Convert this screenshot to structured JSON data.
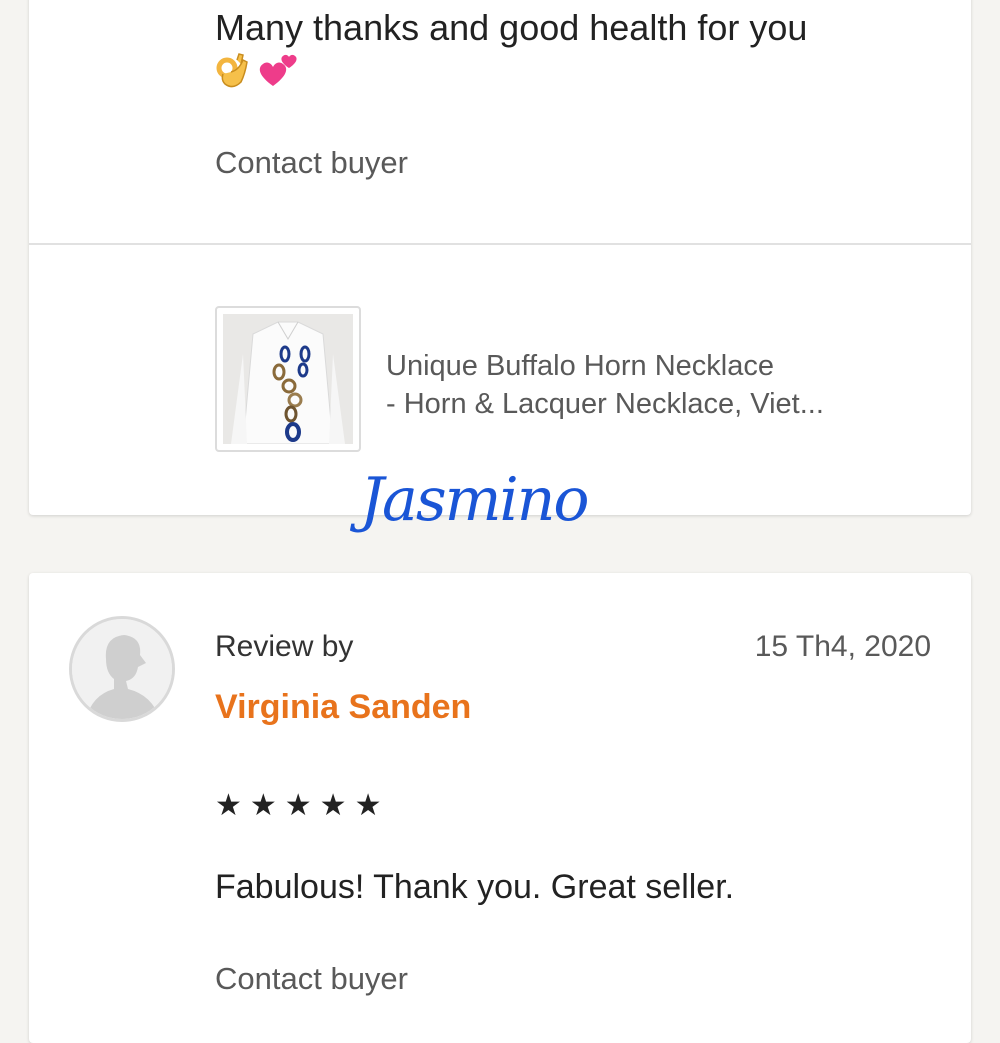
{
  "review_top": {
    "message": "Many thanks and good health for you",
    "emojis": [
      "ok-hand-emoji",
      "two-hearts-emoji"
    ],
    "contact_label": "Contact buyer",
    "listing": {
      "title_line1": "Unique Buffalo Horn Necklace",
      "title_line2": "- Horn & Lacquer Necklace, Viet..."
    }
  },
  "watermark": "Jasmino",
  "review_bottom": {
    "review_by_label": "Review by",
    "date": "15 Th4, 2020",
    "reviewer_name": "Virginia Sanden",
    "rating_stars": "★★★★★",
    "rating": 5,
    "text": "Fabulous!  Thank you.  Great seller.",
    "contact_label": "Contact buyer"
  },
  "colors": {
    "reviewer_name": "#e8731c",
    "watermark": "#1a55d6",
    "background": "#f5f4f1"
  }
}
